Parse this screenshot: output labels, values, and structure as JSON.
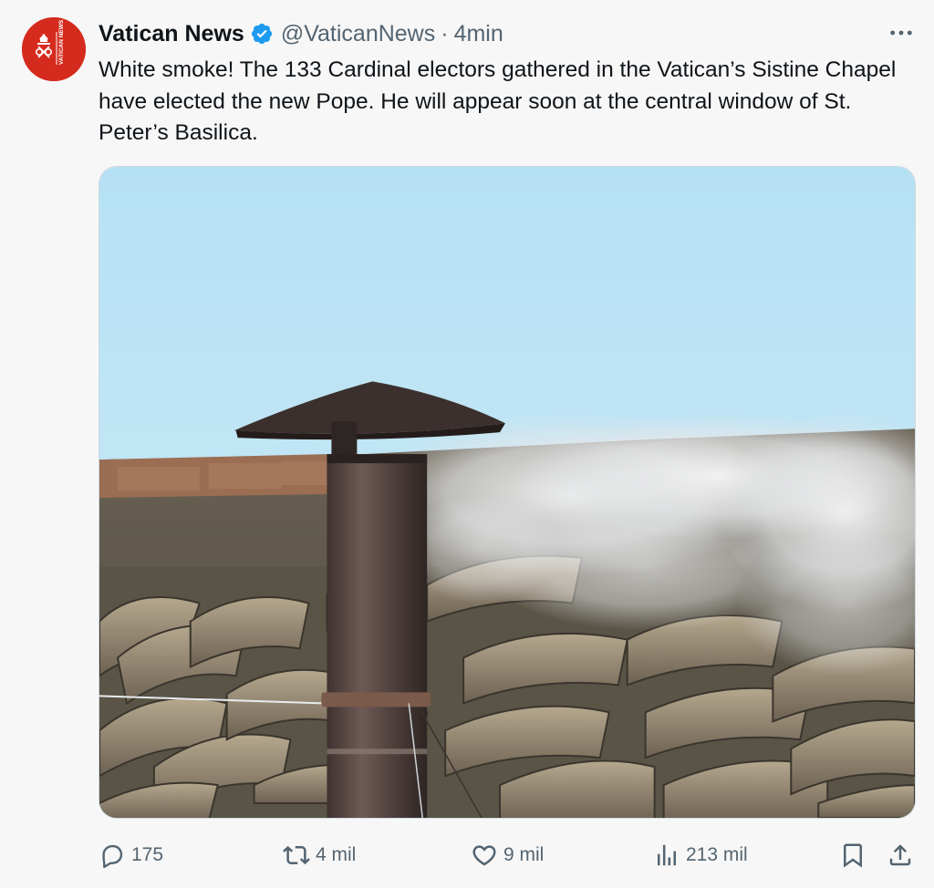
{
  "tweet": {
    "author": {
      "name": "Vatican News",
      "handle": "@VaticanNews",
      "separator": "·",
      "timestamp": "4min",
      "verified": true,
      "avatar_text": "VATICAN NEWS"
    },
    "text": "White smoke! The 133 Cardinal electors gathered in the Vatican’s Sistine Chapel have elected the new Pope. He will appear soon at the central window of St. Peter’s Basilica.",
    "media": {
      "type": "photo"
    },
    "actions": {
      "replies": "175",
      "reposts": "4 mil",
      "likes": "9 mil",
      "views": "213 mil"
    }
  },
  "colors": {
    "brand_red": "#d52b1e",
    "verified_blue": "#1d9bf0",
    "secondary_text": "#536471",
    "sky": "#b8e2f4"
  },
  "icons": [
    "more-icon",
    "verified-badge-icon",
    "reply-icon",
    "retweet-icon",
    "like-icon",
    "views-icon",
    "bookmark-icon",
    "share-icon"
  ]
}
